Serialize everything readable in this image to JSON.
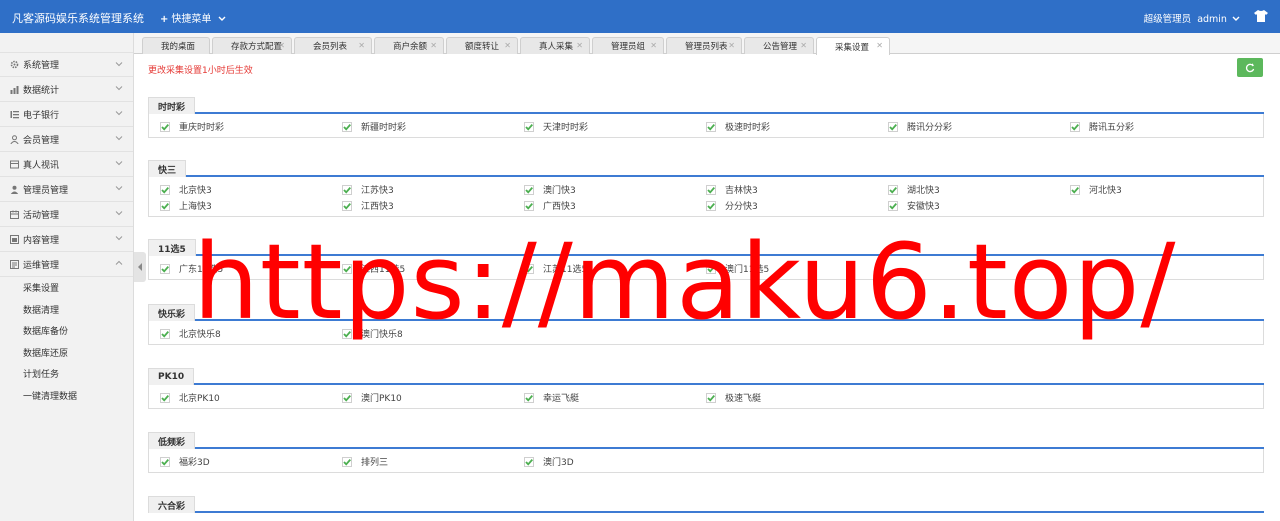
{
  "header": {
    "brand": "凡客源码娱乐系统管理系统",
    "quick_menu": "快捷菜单",
    "role": "超级管理员",
    "user": "admin"
  },
  "sidebar": {
    "items": [
      {
        "label": "系统管理",
        "icon": "gear-icon"
      },
      {
        "label": "数据统计",
        "icon": "bar-chart-icon"
      },
      {
        "label": "电子银行",
        "icon": "list-icon"
      },
      {
        "label": "会员管理",
        "icon": "user-icon"
      },
      {
        "label": "真人视讯",
        "icon": "video-icon"
      },
      {
        "label": "管理员管理",
        "icon": "admin-icon"
      },
      {
        "label": "活动管理",
        "icon": "calendar-icon"
      },
      {
        "label": "内容管理",
        "icon": "content-icon"
      },
      {
        "label": "运维管理",
        "icon": "ops-icon"
      }
    ],
    "sub_items": [
      "采集设置",
      "数据清理",
      "数据库备份",
      "数据库还原",
      "计划任务",
      "一键清理数据"
    ]
  },
  "tabs": [
    {
      "label": "我的桌面",
      "closable": false
    },
    {
      "label": "存款方式配置",
      "closable": true
    },
    {
      "label": "会员列表",
      "closable": true
    },
    {
      "label": "商户余额",
      "closable": true
    },
    {
      "label": "额度转让",
      "closable": true
    },
    {
      "label": "真人采集",
      "closable": true
    },
    {
      "label": "管理员组",
      "closable": true
    },
    {
      "label": "管理员列表",
      "closable": true
    },
    {
      "label": "公告管理",
      "closable": true
    },
    {
      "label": "采集设置",
      "closable": true,
      "active": true
    }
  ],
  "notice": "更改采集设置1小时后生效",
  "sections": [
    {
      "title": "时时彩",
      "items": [
        "重庆时时彩",
        "新疆时时彩",
        "天津时时彩",
        "极速时时彩",
        "腾讯分分彩",
        "腾讯五分彩"
      ]
    },
    {
      "title": "快三",
      "items": [
        "北京快3",
        "江苏快3",
        "澳门快3",
        "吉林快3",
        "湖北快3",
        "河北快3",
        "上海快3",
        "江西快3",
        "广西快3",
        "分分快3",
        "安徽快3"
      ]
    },
    {
      "title": "11选5",
      "items": [
        "广东11选5",
        "江西11选5",
        "江苏11选5",
        "澳门11选5"
      ]
    },
    {
      "title": "快乐彩",
      "items": [
        "北京快乐8",
        "澳门快乐8"
      ]
    },
    {
      "title": "PK10",
      "items": [
        "北京PK10",
        "澳门PK10",
        "幸运飞艇",
        "极速飞艇"
      ]
    },
    {
      "title": "低频彩",
      "items": [
        "福彩3D",
        "排列三",
        "澳门3D"
      ]
    },
    {
      "title": "六合彩",
      "items": []
    }
  ],
  "watermark": "https://maku6.top/",
  "colors": {
    "header": "#2f6fc7",
    "accent_line": "#3d7bd3",
    "check": "#4caf50",
    "notice": "#e53935",
    "refresh": "#5cb85c",
    "watermark": "#ff0000"
  }
}
